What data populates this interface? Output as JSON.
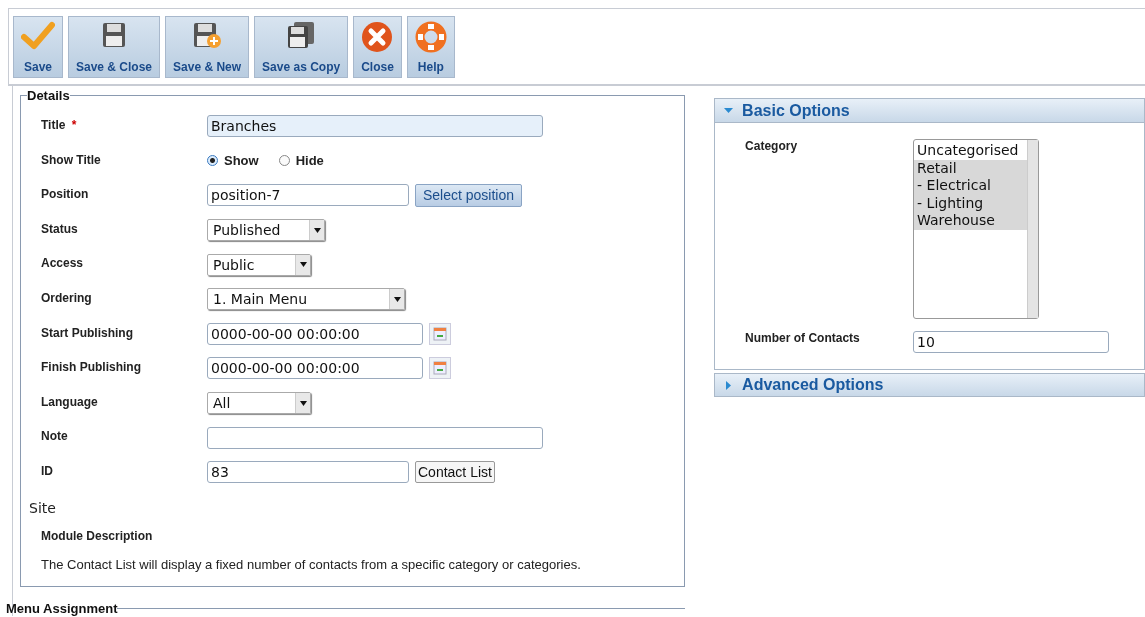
{
  "toolbar": [
    {
      "label": "Save"
    },
    {
      "label": "Save & Close"
    },
    {
      "label": "Save & New"
    },
    {
      "label": "Save as Copy"
    },
    {
      "label": "Close"
    },
    {
      "label": "Help"
    }
  ],
  "details": {
    "legend": "Details",
    "fields": [
      {
        "kind": "text",
        "label": "Title",
        "required": "*",
        "value": "Branches",
        "focused": true
      },
      {
        "kind": "radio",
        "label": "Show Title",
        "options": [
          {
            "label": "Show",
            "selected": true
          },
          {
            "label": "Hide",
            "selected": false
          }
        ]
      },
      {
        "kind": "text",
        "label": "Position",
        "value": "position-7",
        "focused": false,
        "button": {
          "label": "Select position"
        }
      },
      {
        "kind": "select",
        "label": "Status",
        "value": "Published"
      },
      {
        "kind": "select",
        "label": "Access",
        "value": "Public"
      },
      {
        "kind": "select",
        "label": "Ordering",
        "value": "1. Main Menu"
      },
      {
        "kind": "date",
        "label": "Start Publishing",
        "value": "0000-00-00 00:00:00"
      },
      {
        "kind": "date",
        "label": "Finish Publishing",
        "value": "0000-00-00 00:00:00"
      },
      {
        "kind": "select",
        "label": "Language",
        "value": "All"
      },
      {
        "kind": "text",
        "label": "Note",
        "focused": false
      },
      {
        "kind": "text",
        "label": "ID",
        "value": "83",
        "focused": false,
        "button": {
          "label": "Contact List"
        }
      }
    ],
    "site": "Site",
    "description_label": "Module Description",
    "description": "The Contact List will display a fixed number of contacts from a specific category or categories."
  },
  "menu_assignment": {
    "legend": "Menu Assignment"
  },
  "basic_options": {
    "title": "Basic Options",
    "expanded": true,
    "category_label": "Category",
    "categories": [
      {
        "label": "Uncategorised",
        "selected": false
      },
      {
        "label": "Retail",
        "selected": true
      },
      {
        "label": "- Electrical",
        "selected": true
      },
      {
        "label": "- Lighting",
        "selected": true
      },
      {
        "label": "Warehouse",
        "selected": true
      }
    ],
    "contacts_label": "Number of Contacts",
    "contacts_value": "10"
  },
  "advanced_options": {
    "title": "Advanced Options",
    "expanded": false
  }
}
